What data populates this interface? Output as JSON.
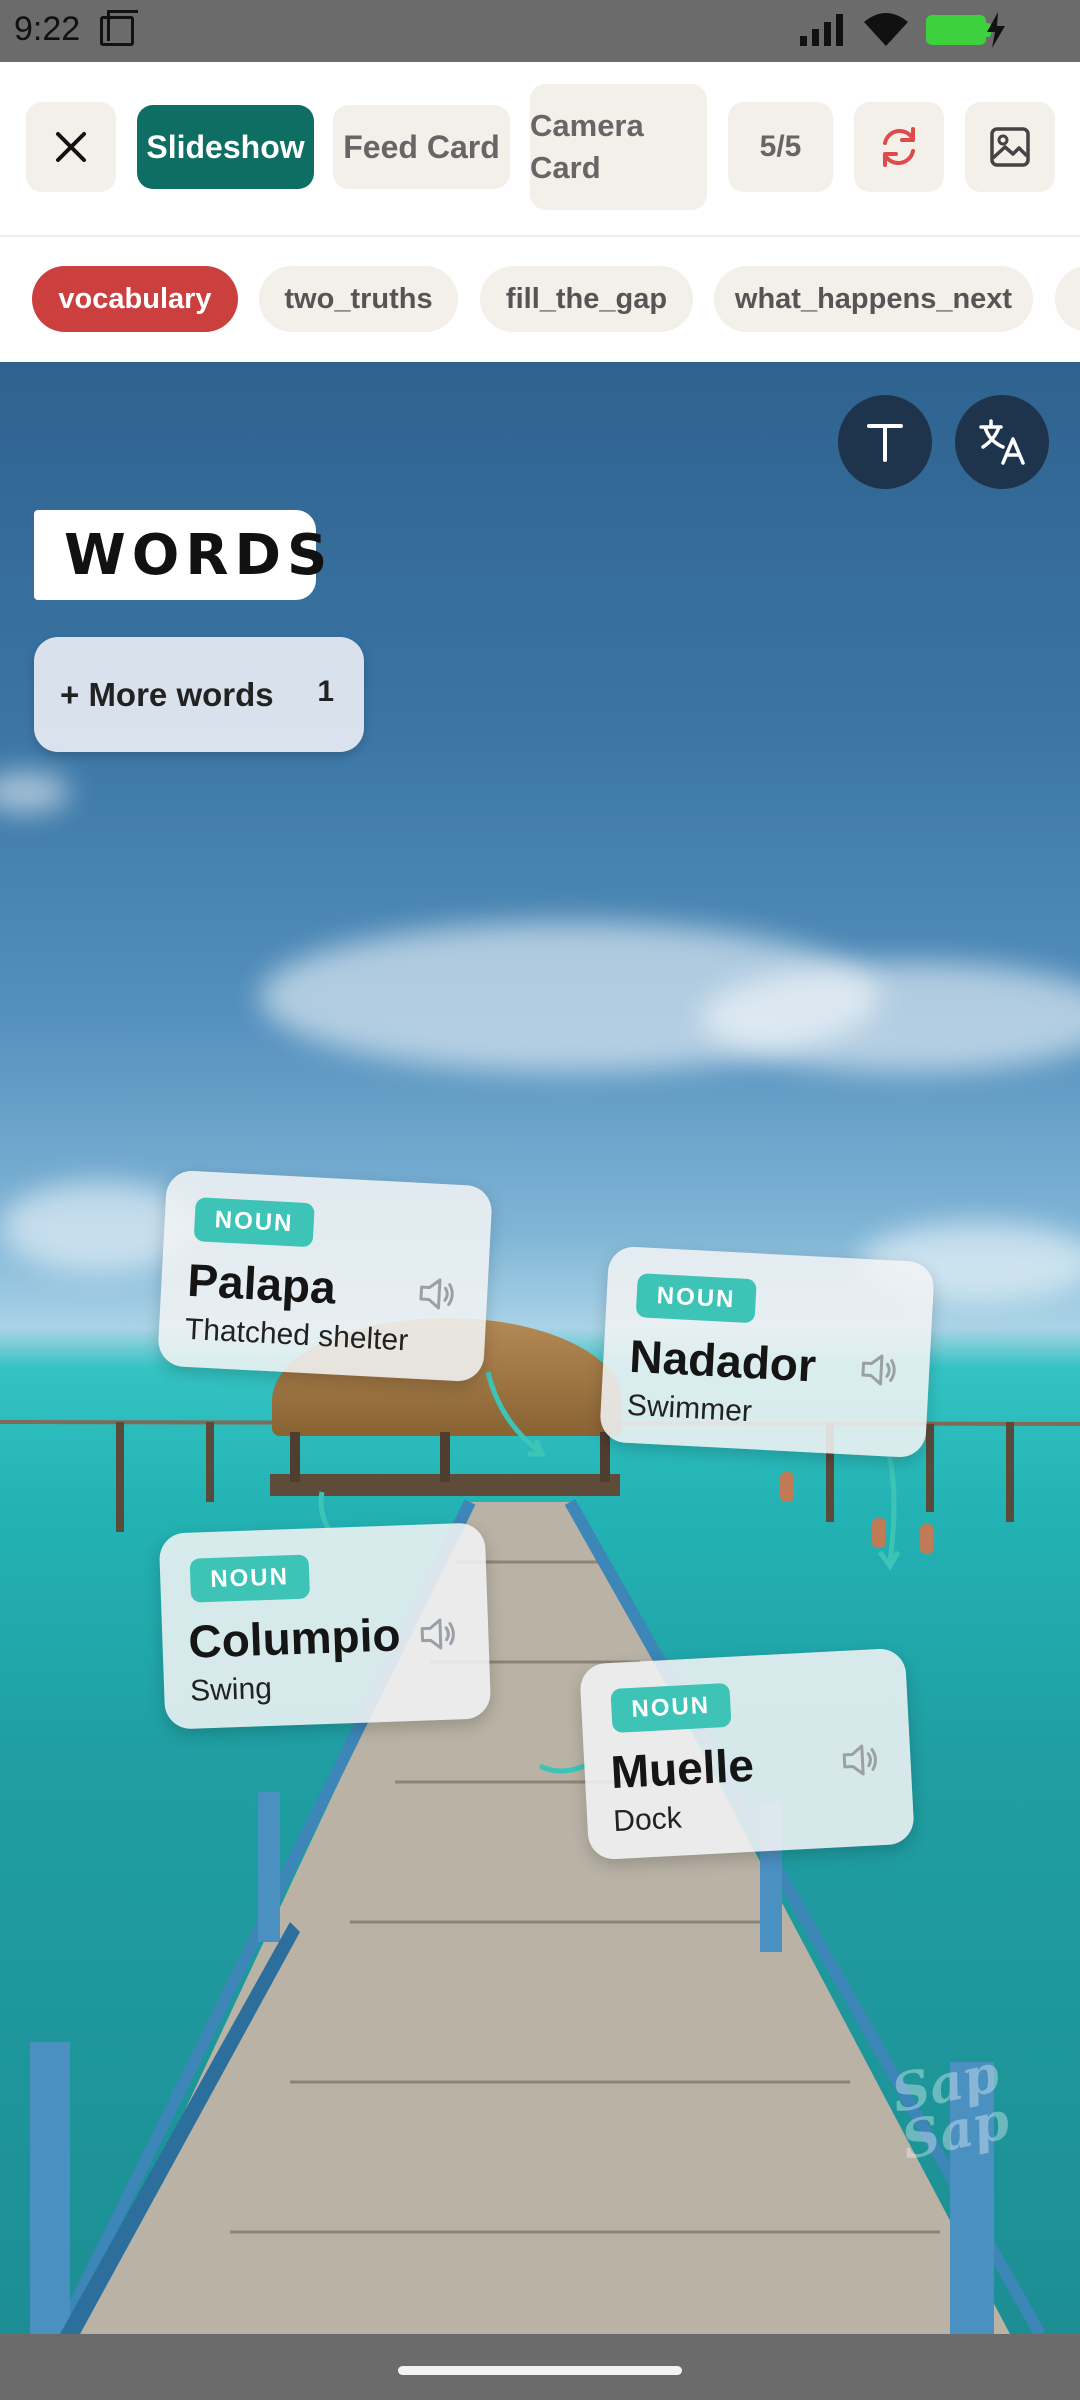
{
  "status_bar": {
    "time": "9:22"
  },
  "toolbar": {
    "modes": [
      {
        "label": "Slideshow",
        "active": true
      },
      {
        "label": "Feed Card",
        "active": false
      },
      {
        "label": "Camera Card",
        "active": false
      }
    ],
    "counter": "5/5",
    "icons": [
      "close-icon",
      "refresh-icon",
      "image-icon"
    ]
  },
  "chips": [
    {
      "label": "vocabulary",
      "active": true
    },
    {
      "label": "two_truths",
      "active": false
    },
    {
      "label": "fill_the_gap",
      "active": false
    },
    {
      "label": "what_happens_next",
      "active": false
    }
  ],
  "scene": {
    "title": "WORDS",
    "more_words": {
      "label": "+ More words",
      "count": "1"
    },
    "cards": [
      {
        "pos": "NOUN",
        "word": "Palapa",
        "meaning": "Thatched shelter"
      },
      {
        "pos": "NOUN",
        "word": "Nadador",
        "meaning": "Swimmer"
      },
      {
        "pos": "NOUN",
        "word": "Columpio",
        "meaning": "Swing"
      },
      {
        "pos": "NOUN",
        "word": "Muelle",
        "meaning": "Dock"
      }
    ],
    "watermark": "Sap Sap"
  },
  "colors": {
    "primary_active": "#0f6e63",
    "chip_active": "#cc3f3f",
    "tag": "#3ec4b7",
    "round_button": "#1e344d",
    "refresh_icon": "#e04a4a"
  }
}
